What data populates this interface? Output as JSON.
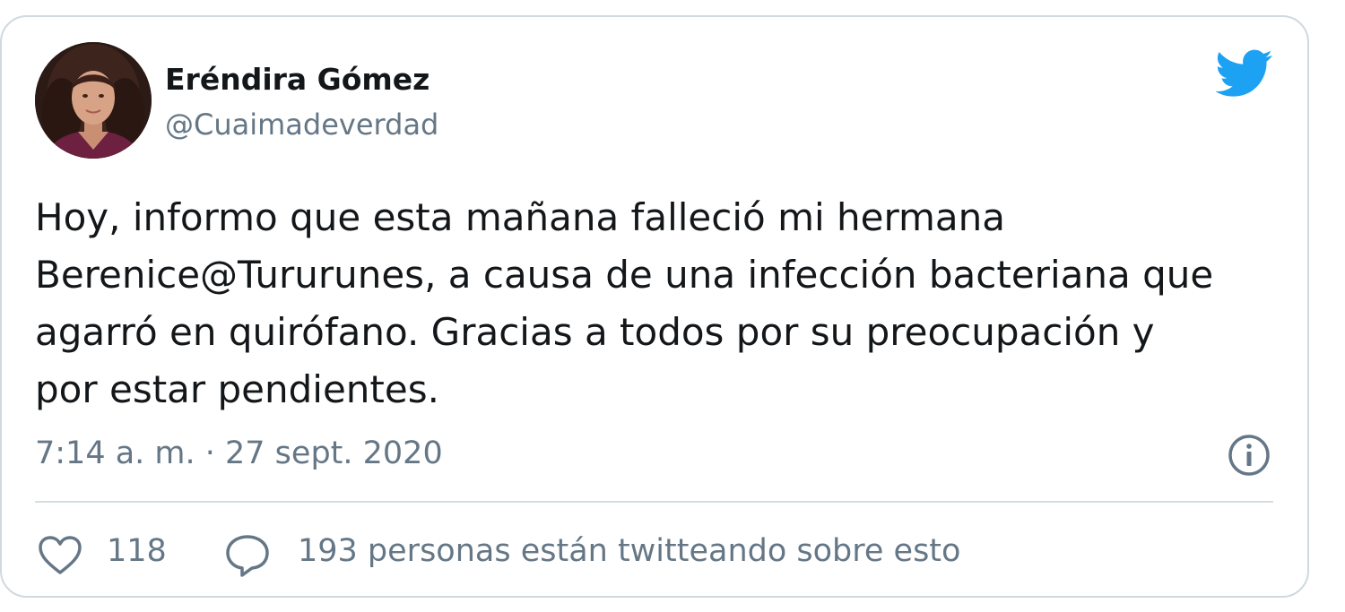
{
  "author": {
    "name": "Eréndira Gómez",
    "handle": "@Cuaimadeverdad"
  },
  "tweet": {
    "text_lines": [
      "Hoy, informo que esta mañana falleció mi hermana",
      "Berenice@Tururunes, a causa de una infección bacteriana que",
      "agarró en quirófano. Gracias a todos por su preocupación y",
      "por estar pendientes."
    ],
    "timestamp": "7:14 a. m. · 27 sept. 2020"
  },
  "actions": {
    "likes": "118",
    "conversation": "193 personas están twitteando sobre esto"
  },
  "icons": {
    "brand": "twitter-bird-icon",
    "info": "info-icon",
    "like": "heart-icon",
    "reply": "speech-bubble-icon"
  },
  "colors": {
    "brand_blue": "#1da1f2",
    "text_primary": "#14171a",
    "text_secondary": "#657786",
    "border": "#cfd9de"
  }
}
